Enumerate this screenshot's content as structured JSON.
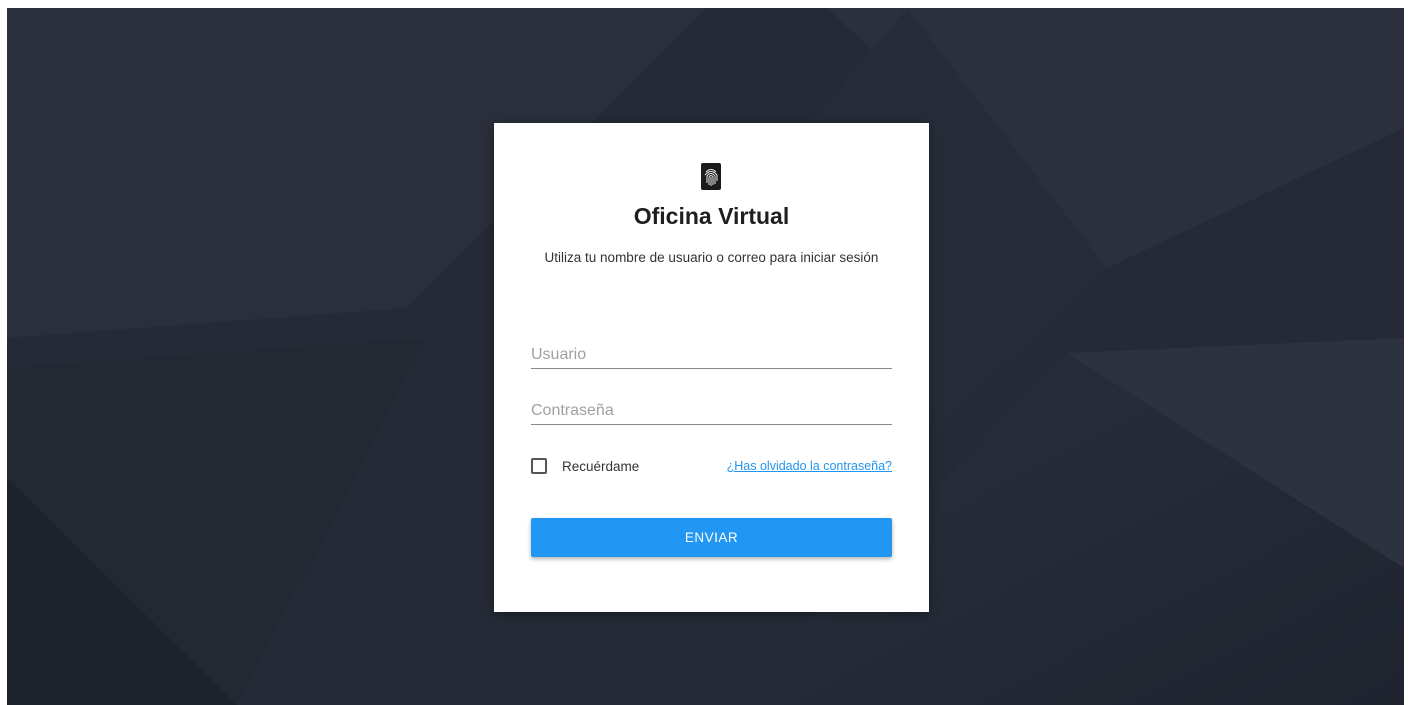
{
  "login": {
    "title": "Oficina Virtual",
    "subtitle": "Utiliza tu nombre de usuario o correo para iniciar sesión",
    "username_placeholder": "Usuario",
    "password_placeholder": "Contraseña",
    "remember_label": "Recuérdame",
    "forgot_link": "¿Has olvidado la contraseña?",
    "submit_label": "ENVIAR",
    "logo_icon": "fingerprint-icon"
  },
  "colors": {
    "background": "#252a36",
    "accent": "#2196f3",
    "card": "#ffffff"
  }
}
